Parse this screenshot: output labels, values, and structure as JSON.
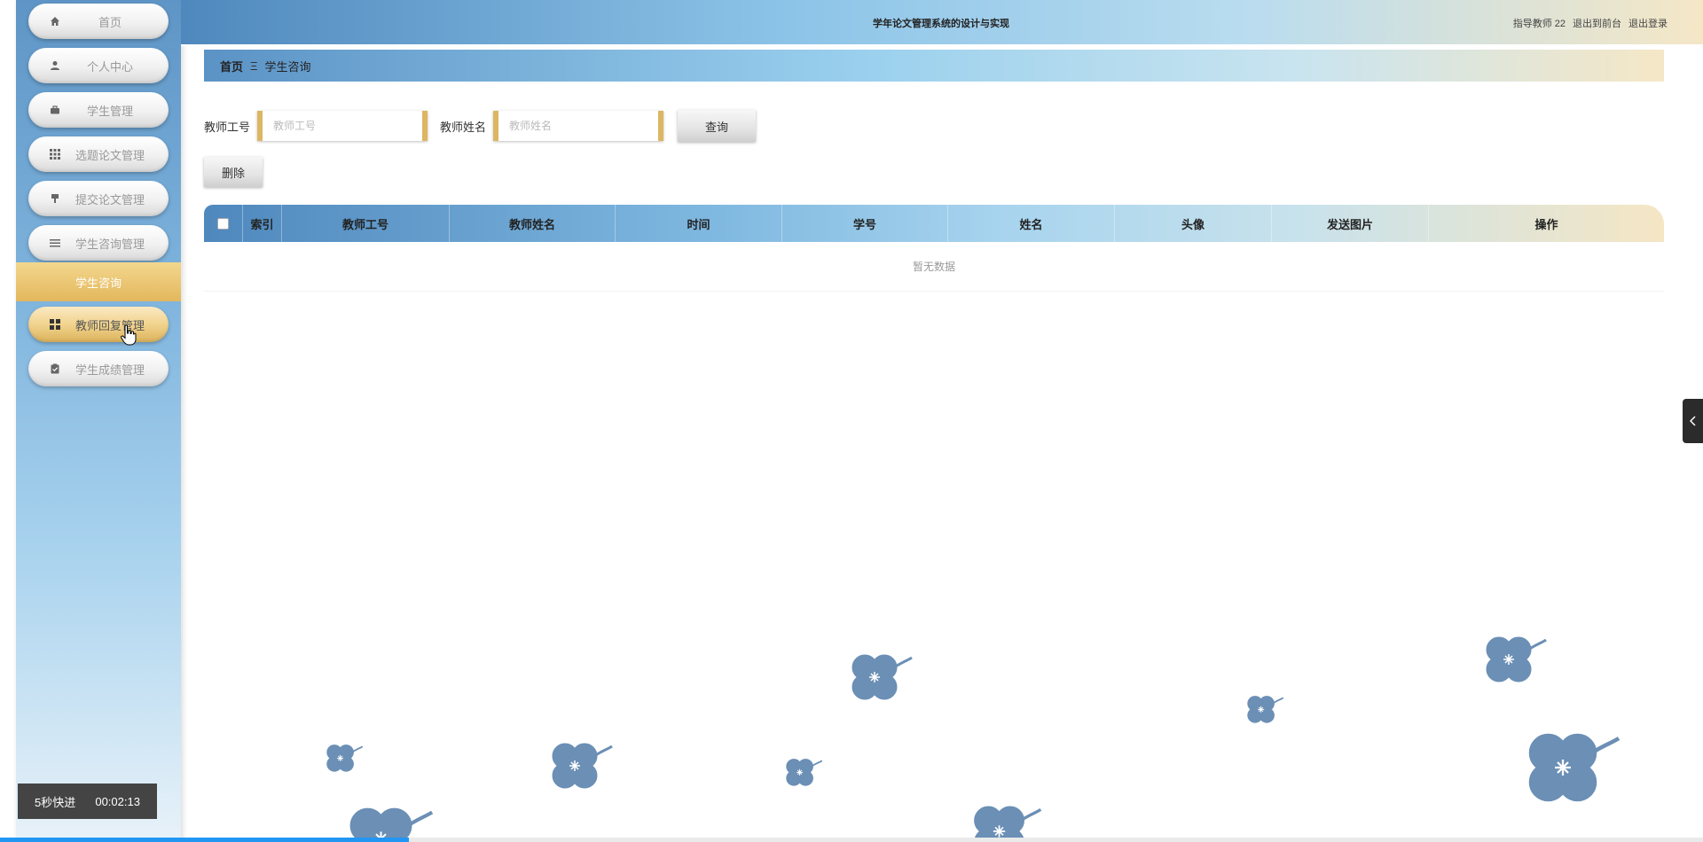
{
  "header": {
    "title": "学年论文管理系统的设计与实现",
    "user_label": "指导教师 22",
    "exit_front": "退出到前台",
    "logout": "退出登录"
  },
  "sidebar": {
    "items": [
      {
        "label": "首页",
        "icon": "home-icon"
      },
      {
        "label": "个人中心",
        "icon": "user-icon"
      },
      {
        "label": "学生管理",
        "icon": "briefcase-icon"
      },
      {
        "label": "选题论文管理",
        "icon": "grid-icon"
      },
      {
        "label": "提交论文管理",
        "icon": "pin-icon"
      },
      {
        "label": "学生咨询管理",
        "icon": "list-icon"
      },
      {
        "label": "教师回复管理",
        "icon": "apps-icon"
      },
      {
        "label": "学生成绩管理",
        "icon": "clipboard-icon"
      }
    ],
    "sub_item": "学生咨询"
  },
  "breadcrumb": {
    "home": "首页",
    "separator": "Ξ",
    "current": "学生咨询"
  },
  "search": {
    "teacher_id_label": "教师工号",
    "teacher_id_placeholder": "教师工号",
    "teacher_name_label": "教师姓名",
    "teacher_name_placeholder": "教师姓名",
    "query_button": "查询"
  },
  "actions": {
    "delete_button": "删除"
  },
  "table": {
    "columns": [
      "索引",
      "教师工号",
      "教师姓名",
      "时间",
      "学号",
      "姓名",
      "头像",
      "发送图片",
      "操作"
    ],
    "empty_text": "暂无数据"
  },
  "video": {
    "skip_label": "5秒快进",
    "time": "00:02:13",
    "progress": 0.24
  },
  "colors": {
    "accent_gold": "#dcb662",
    "accent_blue": "#4f88bd",
    "clover": "#6b8fb5",
    "progress": "#2196f3"
  }
}
